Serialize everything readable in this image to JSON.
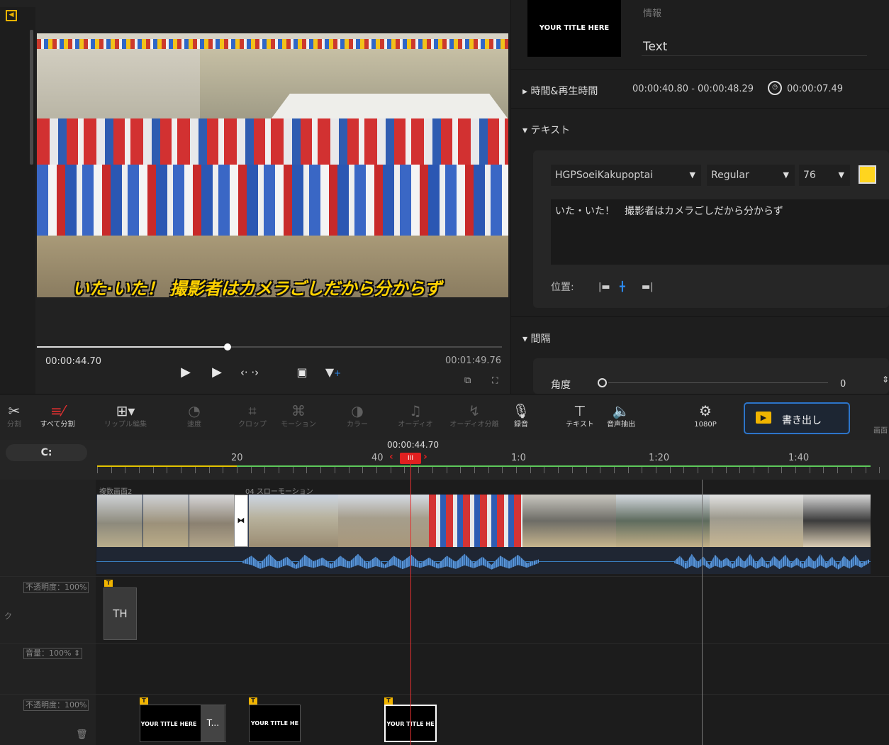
{
  "preview": {
    "subtitle": "いた·いた！ 撮影者はカメラごしだから分からず",
    "current_time": "00:00:44.70",
    "total_time": "00:01:49.76",
    "progress": 0.41
  },
  "panel": {
    "thumb_text": "YOUR TITLE HERE",
    "info_label": "情報",
    "text_label": "Text",
    "time_section": "時間&再生時間",
    "time_range": "00:00:40.80 - 00:00:48.29",
    "duration": "00:00:07.49",
    "text_section": "テキスト",
    "font": "HGPSoeiKakupoptai",
    "weight": "Regular",
    "size": "76",
    "text_color": "#ffd51f",
    "text_content": "いた・いた！　撮影者はカメラごしだから分からず",
    "position_label": "位置:",
    "spacing_section": "間隔",
    "angle_label": "角度",
    "angle_value": "0"
  },
  "toolbar": {
    "split": "分割",
    "split_all": "すべて分割",
    "ripple": "リップル編集",
    "speed": "速度",
    "crop": "クロップ",
    "motion": "モーション",
    "color": "カラー",
    "audio": "オーディオ",
    "audio_split": "オーディオ分離",
    "record": "録音",
    "text": "テキスト",
    "tts": "音声抽出",
    "resolution": "1080P",
    "export": "書き出し",
    "screen": "画面"
  },
  "timeline": {
    "playhead_time": "00:00:44.70",
    "ticks": [
      "20",
      "40",
      "1:0",
      "1:20",
      "1:40"
    ],
    "clip1_label": "複数画面2",
    "clip2_label": "04 スローモーション",
    "opacity_badge": "不透明度：100%",
    "volume_badge": "音量：100%",
    "text_clip_label": "TH",
    "title_clips": [
      "YOUR TITLE HERE",
      "T...",
      "YOUR TITLE HE",
      "YOUR TITLE HE"
    ]
  }
}
